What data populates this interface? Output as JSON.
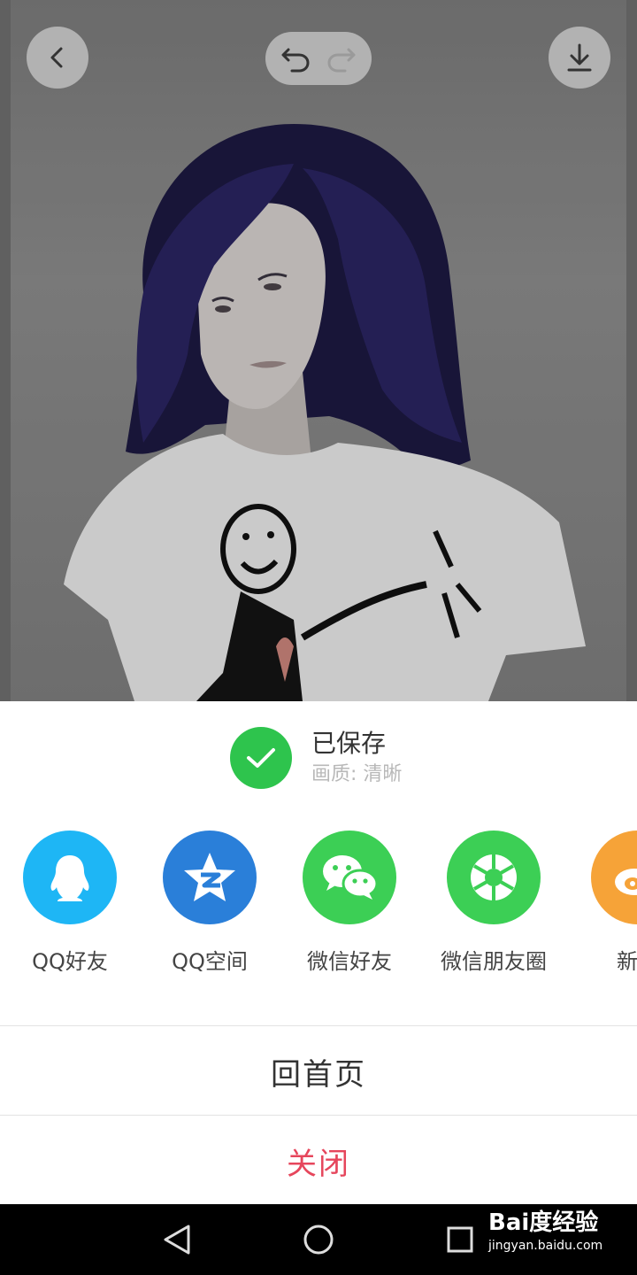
{
  "editor": {
    "back_icon": "chevron-left-icon",
    "undo_icon": "undo-icon",
    "redo_icon": "redo-icon",
    "download_icon": "download-icon"
  },
  "saved": {
    "title": "已保存",
    "quality": "画质: 清晰",
    "check_color": "#2ec44d"
  },
  "share_targets": [
    {
      "label": "QQ好友",
      "icon": "qq-icon",
      "color": "#1eb6f5"
    },
    {
      "label": "QQ空间",
      "icon": "qzone-icon",
      "color": "#2a7fd9"
    },
    {
      "label": "微信好友",
      "icon": "wechat-icon",
      "color": "#3ccf55"
    },
    {
      "label": "微信朋友圈",
      "icon": "wechat-moments-icon",
      "color": "#3ccf55"
    },
    {
      "label": "新浪",
      "icon": "weibo-icon",
      "color": "#f6a338"
    }
  ],
  "actions": {
    "home": "回首页",
    "close": "关闭",
    "close_color": "#e6465c"
  },
  "watermark": {
    "logo": "Bai度经验",
    "url": "jingyan.baidu.com"
  }
}
